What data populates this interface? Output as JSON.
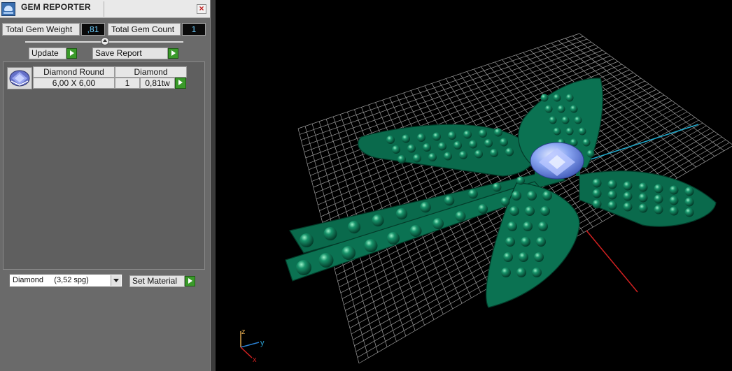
{
  "window": {
    "title": "GEM REPORTER",
    "close_label": "×"
  },
  "summary": {
    "total_weight_label": "Total Gem Weight",
    "total_weight_value": ",81",
    "total_count_label": "Total Gem Count",
    "total_count_value": "1"
  },
  "actions": {
    "update_label": "Update",
    "save_report_label": "Save Report"
  },
  "gem_table": {
    "headers": [
      "Diamond Round",
      "Diamond"
    ],
    "rows": [
      {
        "size": "6,00 X 6,00",
        "count": "1",
        "weight": "0,81tw"
      }
    ]
  },
  "material": {
    "selected": "Diamond     (3,52 spg)",
    "set_material_label": "Set Material"
  },
  "viewport": {
    "axis_labels": {
      "z": "z",
      "y": "y",
      "x": "x"
    },
    "colors": {
      "model": "#0a6a4c",
      "gem": "#8aa6f2",
      "grid": "#d0d0d0",
      "x_axis": "#d02020",
      "y_axis": "#1fa7c9",
      "z_axis": "#d9a24a"
    }
  }
}
